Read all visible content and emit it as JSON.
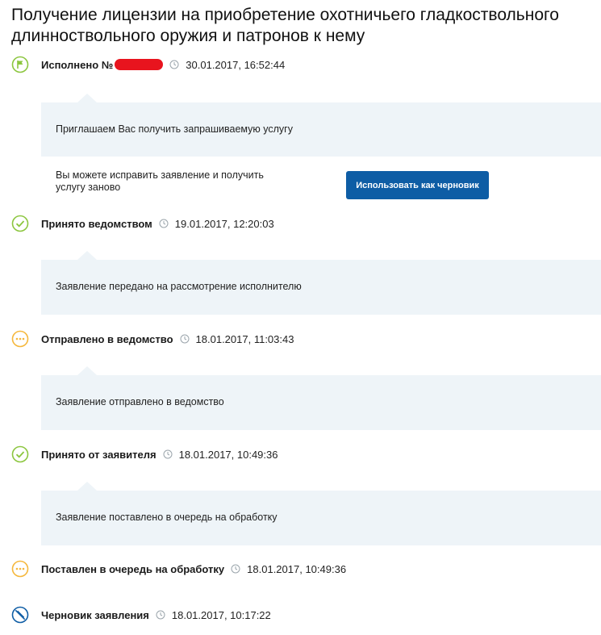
{
  "page": {
    "title": "Получение лицензии на приобретение охотничьего гладкоствольного длинноствольного оружия и патронов к нему"
  },
  "colors": {
    "success": "#8cc63f",
    "pending": "#f5b73b",
    "draft": "#0e5da5",
    "panel_bg": "#eef4f8",
    "button_bg": "#0e5da5",
    "redaction": "#e8141e"
  },
  "timeline": [
    {
      "icon": "flag-icon",
      "label": "Исполнено №",
      "time": "30.01.2017, 16:52:44",
      "message": "Приглашаем Вас получить запрашиваемую услугу",
      "hint": "Вы можете исправить заявление и получить услугу заново",
      "button": "Использовать как черновик"
    },
    {
      "icon": "checkmark-icon",
      "label": "Принято ведомством",
      "time": "19.01.2017, 12:20:03",
      "message": "Заявление передано на рассмотрение исполнителю"
    },
    {
      "icon": "ellipsis-icon",
      "label": "Отправлено в ведомство",
      "time": "18.01.2017, 11:03:43",
      "message": "Заявление отправлено в ведомство"
    },
    {
      "icon": "checkmark-icon",
      "label": "Принято от заявителя",
      "time": "18.01.2017, 10:49:36",
      "message": "Заявление поставлено в очередь на обработку"
    },
    {
      "icon": "ellipsis-icon",
      "label": "Поставлен в очередь на обработку",
      "time": "18.01.2017, 10:49:36"
    },
    {
      "icon": "cancel-icon",
      "label": "Черновик заявления",
      "time": "18.01.2017, 10:17:22"
    }
  ]
}
